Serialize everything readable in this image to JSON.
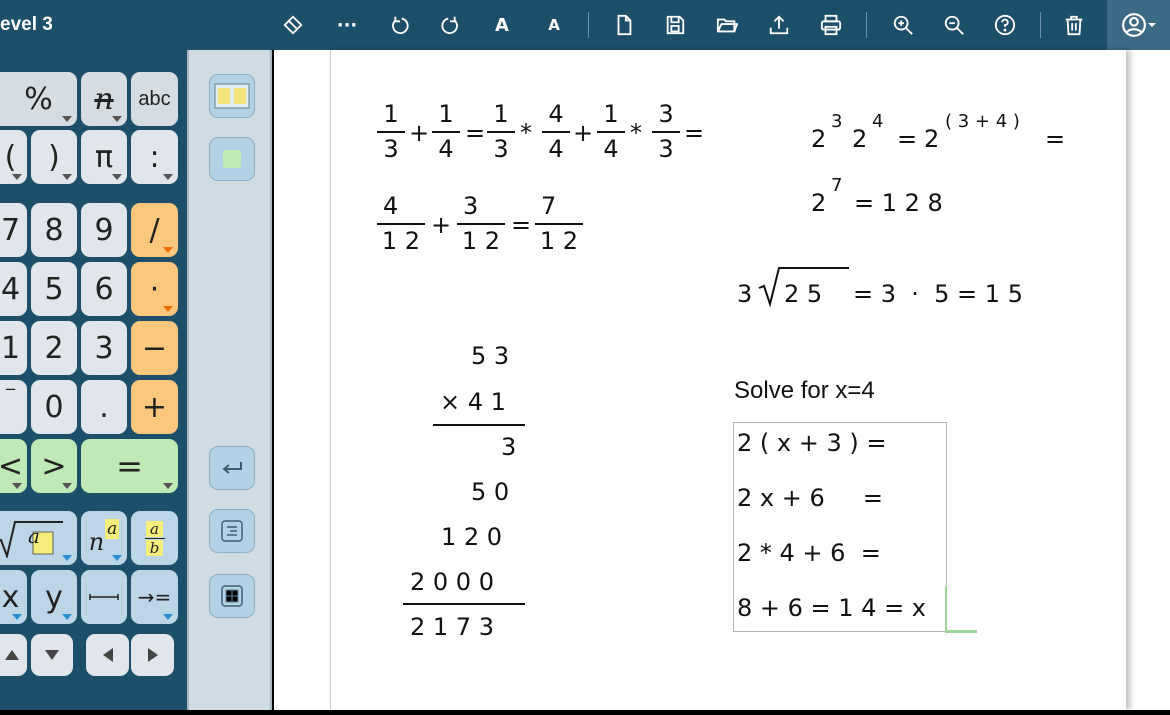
{
  "app": {
    "title": "evel 3"
  },
  "toolbar": {
    "more_label": "···",
    "font_larger_label": "A",
    "font_smaller_label": "A"
  },
  "keypad": {
    "row1": [
      "%",
      "n",
      "abc"
    ],
    "row2": [
      "(",
      ")",
      "π",
      ":"
    ],
    "row3": [
      "7",
      "8",
      "9",
      "/"
    ],
    "row4": [
      "4",
      "5",
      "6",
      "·"
    ],
    "row5": [
      "1",
      "2",
      "3",
      "−"
    ],
    "row6": [
      "0",
      ".",
      "+"
    ],
    "row7": [
      "<",
      ">",
      "="
    ],
    "row8": [
      "a",
      "n",
      "a",
      "a",
      "b"
    ],
    "row9": [
      "x",
      "y",
      "→="
    ]
  },
  "colors": {
    "toolbar": "#1d4f6b",
    "orange_key": "#fac77c",
    "green_key": "#bfe9b5",
    "strip": "#cfdce4"
  },
  "math": {
    "eq1": {
      "fracs": [
        [
          "1",
          "3"
        ],
        [
          "1",
          "4"
        ],
        [
          "1",
          "3"
        ],
        [
          "4",
          "4"
        ],
        [
          "1",
          "4"
        ],
        [
          "3",
          "3"
        ]
      ],
      "ops": [
        "+",
        "=",
        "*",
        "+",
        "*",
        "="
      ]
    },
    "eq2": {
      "fracs": [
        [
          "4",
          "1 2"
        ],
        [
          "3",
          "1 2"
        ],
        [
          "7",
          "1 2"
        ]
      ],
      "ops": [
        "+",
        "="
      ]
    },
    "exp1": {
      "b1": "2",
      "e1": "3",
      "b2": "2",
      "e2": "4",
      "eq": "=",
      "b3": "2",
      "e3": "( 3 + 4 )",
      "eq2": "="
    },
    "exp2": {
      "base": "2",
      "exp": "7",
      "rest": "= 1 2 8"
    },
    "sqrt": {
      "coef": "3",
      "radicand": "2 5",
      "rest": "= 3  ·  5 = 1 5"
    },
    "mult": {
      "lines": [
        "5 3",
        "× 4 1",
        "3",
        "5 0",
        "1 2 0",
        "2 0 0 0",
        "2 1 7 3"
      ]
    },
    "solve": {
      "title": "Solve for x=4",
      "lines": [
        "2 ( x + 3 ) =",
        "2 x + 6     =",
        "2 * 4 + 6  =",
        "8 + 6 = 1 4 = x"
      ]
    }
  }
}
